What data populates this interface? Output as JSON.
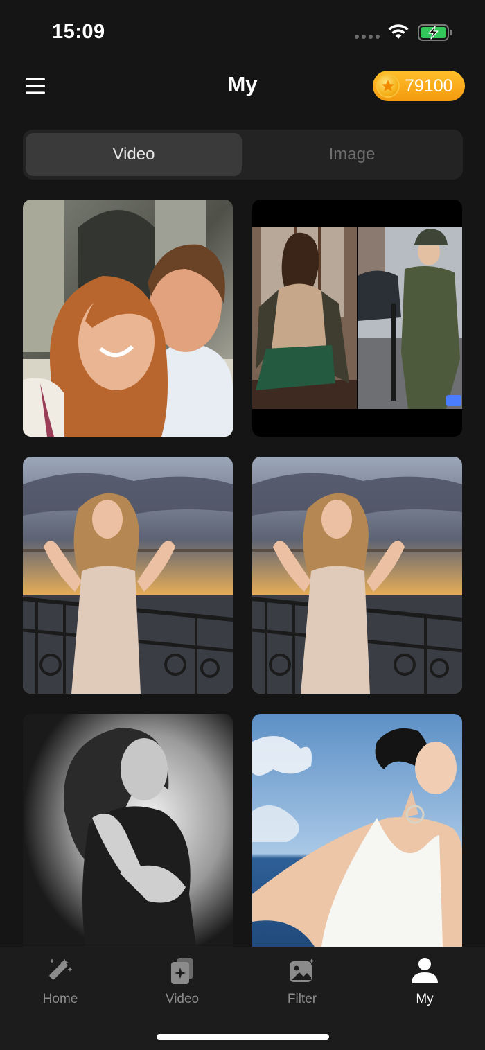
{
  "status_bar": {
    "time": "15:09"
  },
  "header": {
    "title": "My",
    "menu_icon": "hamburger-menu-icon",
    "coins": {
      "icon": "star-coin-icon",
      "value": "79100"
    }
  },
  "segments": {
    "items": [
      {
        "label": "Video",
        "selected": true
      },
      {
        "label": "Image",
        "selected": false
      }
    ]
  },
  "gallery": {
    "items": [
      {
        "name": "couple-photo"
      },
      {
        "name": "two-person-video-collage"
      },
      {
        "name": "woman-sunset-photo"
      },
      {
        "name": "woman-sunset-photo"
      },
      {
        "name": "bw-portrait-photo"
      },
      {
        "name": "woman-seaside-photo"
      }
    ]
  },
  "tab_bar": {
    "tabs": [
      {
        "label": "Home",
        "icon": "magic-wand-icon",
        "active": false
      },
      {
        "label": "Video",
        "icon": "video-cards-icon",
        "active": false
      },
      {
        "label": "Filter",
        "icon": "image-sparkle-icon",
        "active": false
      },
      {
        "label": "My",
        "icon": "person-icon",
        "active": true
      }
    ]
  },
  "colors": {
    "background": "#151515",
    "coin_badge": "#f6a714",
    "segment_selected": "#3a3a3a",
    "tab_inactive": "#8b8b8b",
    "tab_active": "#ffffff"
  }
}
